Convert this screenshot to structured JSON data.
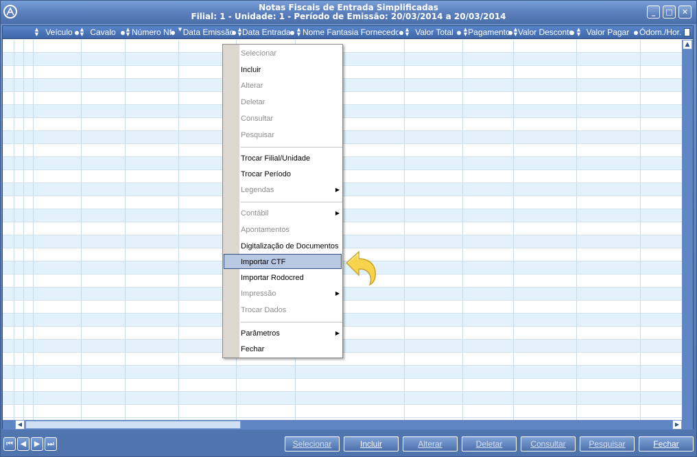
{
  "window": {
    "title_line1": "Notas Fiscais de Entrada Simplificadas",
    "title_line2": "Filial: 1 - Unidade: 1 - Período de Emissão: 20/03/2014 a 20/03/2014",
    "logo_icon": "app-logo-icon",
    "controls": {
      "minimize": "_",
      "maximize": "□",
      "close": "✕"
    }
  },
  "grid": {
    "columns": [
      {
        "label": "Veículo"
      },
      {
        "label": "Cavalo"
      },
      {
        "label": "Número Nf"
      },
      {
        "label": "Data Emissão"
      },
      {
        "label": "Data Entrada"
      },
      {
        "label": "Nome Fantasia Fornecedor"
      },
      {
        "label": "Valor Total"
      },
      {
        "label": "Pagamento"
      },
      {
        "label": "Valor Desconto"
      },
      {
        "label": "Valor Pagar"
      },
      {
        "label": "Ódom./Hor. I"
      }
    ],
    "row_count": 29,
    "colors": {
      "header": "#4a72b4",
      "row_alt": "#e3f2fa"
    }
  },
  "context_menu": {
    "items": [
      {
        "label": "Selecionar",
        "disabled": true
      },
      {
        "label": "Incluir",
        "disabled": false
      },
      {
        "label": "Alterar",
        "disabled": true
      },
      {
        "label": "Deletar",
        "disabled": true
      },
      {
        "label": "Consultar",
        "disabled": true
      },
      {
        "label": "Pesquisar",
        "disabled": true
      },
      {
        "label": "Trocar Filial/Unidade",
        "disabled": false
      },
      {
        "label": "Trocar Período",
        "disabled": false
      },
      {
        "label": "Legendas",
        "disabled": true,
        "submenu": true
      },
      {
        "label": "Contábil",
        "disabled": true,
        "submenu": true
      },
      {
        "label": "Apontamentos",
        "disabled": true
      },
      {
        "label": "Digitalização de Documentos",
        "disabled": false
      },
      {
        "label": "Importar CTF",
        "disabled": false,
        "highlighted": true
      },
      {
        "label": "Importar Rodocred",
        "disabled": false
      },
      {
        "label": "Impressão",
        "disabled": true,
        "submenu": true
      },
      {
        "label": "Trocar Dados",
        "disabled": true
      },
      {
        "label": "Parâmetros",
        "disabled": false,
        "submenu": true
      },
      {
        "label": "Fechar",
        "disabled": false
      }
    ],
    "submenu_arrow": "▶"
  },
  "footer": {
    "nav": {
      "first": "⏮",
      "prev": "◀",
      "next": "▶",
      "last": "⏭"
    },
    "buttons": {
      "selecionar": "Selecionar",
      "incluir": "Incluir",
      "alterar": "Alterar",
      "deletar": "Deletar",
      "consultar": "Consultar",
      "pesquisar": "Pesquisar",
      "fechar": "Fechar"
    }
  },
  "scroll": {
    "up": "▲",
    "left": "◀",
    "right": "▶"
  },
  "annotation": {
    "pointer_icon": "curved-arrow-pointer-icon",
    "color": "#f5d24a"
  }
}
